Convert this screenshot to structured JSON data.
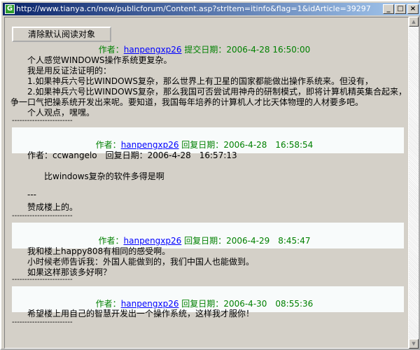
{
  "window": {
    "title": "http://www.tianya.cn/new/publicforum/Content.asp?strItem=itinfo&flag=1&idArticle=39297",
    "minimize": "_",
    "maximize": "□",
    "close": "×"
  },
  "toolbar": {
    "clear_button": "清除默认阅读对象"
  },
  "post": {
    "author_label": "作者：",
    "author": "hanpengxp26",
    "date_label": "提交日期：",
    "date": "2006-4-28 16:50:00",
    "lines": [
      "个人感觉WINDOWS操作系统更复杂。",
      "我是用反证法证明的：",
      "1.如果神兵六号比WINDOWS复杂，那么世界上有卫星的国家都能做出操作系统来。但没有，",
      "2.如果神兵六号比WINDOWS复杂，那么我国可否尝试用神舟的研制模式，即将计算机精英集合起来，",
      "争一口气把操系统开发出来呢。要知道，我国每年培养的计算机人才比天体物理的人材要多吧。",
      "个人观点，嘿嘿。"
    ]
  },
  "separator": "------------------------",
  "replies": [
    {
      "author_label": "作者：",
      "author": "hanpengxp26",
      "date_label": "回复日期：",
      "date": "2006-4-28　16:58:54",
      "quote_header": "作者：ccwangelo　回复日期：2006-4-28　16:57:13",
      "quote": "比windows复杂的软件多得是啊",
      "quote_sep": "---",
      "lines": [
        "赞成楼上的。"
      ]
    },
    {
      "author_label": "作者：",
      "author": "hanpengxp26",
      "date_label": "回复日期：",
      "date": "2006-4-29　8:45:47",
      "lines": [
        "我和楼上happy808有相同的感受啊。",
        "小时候老师告诉我：外国人能做到的，我们中国人也能做到。",
        "如果这样那该多好啊？"
      ]
    },
    {
      "author_label": "作者：",
      "author": "hanpengxp26",
      "date_label": "回复日期：",
      "date": "2006-4-30　08:55:36",
      "lines": [
        "希望楼上用自己的智慧开发出一个操作系统，这样我才服你！"
      ]
    }
  ]
}
